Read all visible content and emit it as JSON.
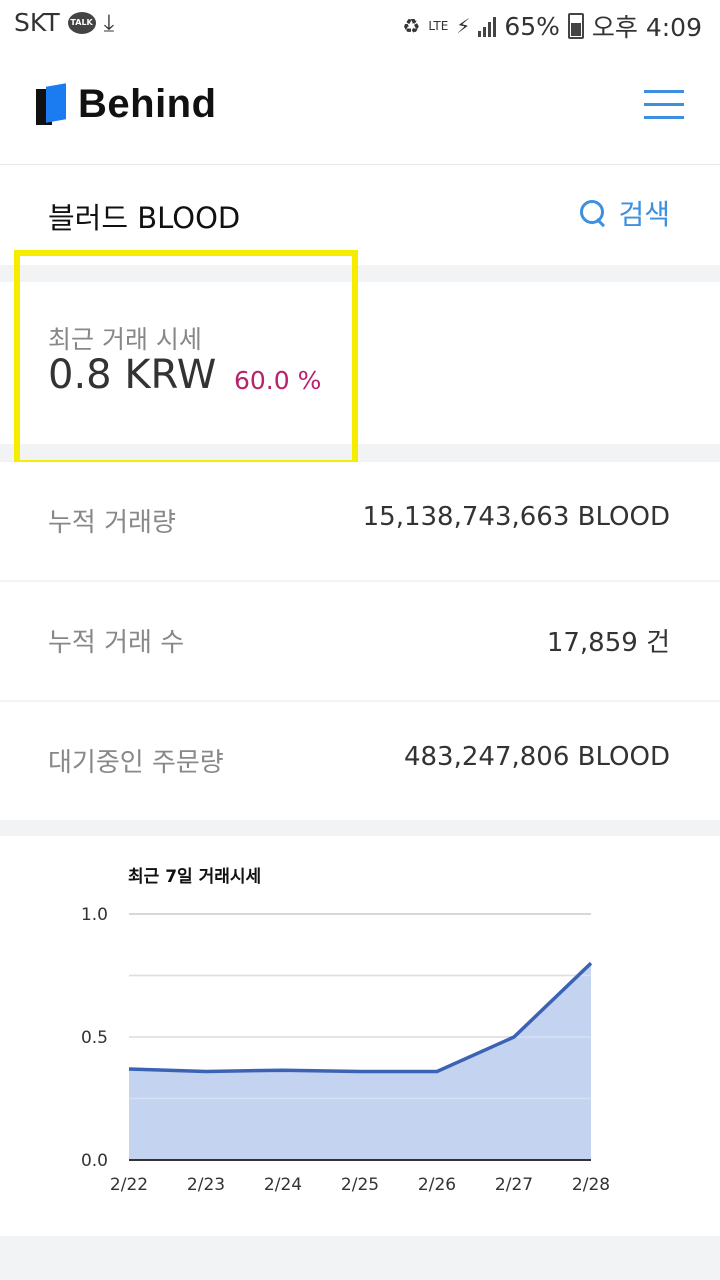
{
  "status_bar": {
    "carrier": "SKT",
    "talk_badge": "TALK",
    "network": "LTE",
    "battery": "65%",
    "time": "오후 4:09"
  },
  "header": {
    "app_name": "Behind"
  },
  "page": {
    "title": "블러드 BLOOD",
    "search_label": "검색"
  },
  "price": {
    "label": "최근 거래 시세",
    "value": "0.8 KRW",
    "change": "60.0 %"
  },
  "stats": [
    {
      "label": "누적 거래량",
      "value": "15,138,743,663 BLOOD"
    },
    {
      "label": "누적 거래 수",
      "value": "17,859 건"
    },
    {
      "label": "대기중인 주문량",
      "value": "483,247,806 BLOOD"
    }
  ],
  "colors": {
    "accent": "#3d8fe0",
    "change": "#b8226a",
    "highlight": "#f5ec00",
    "line": "#3b63b5",
    "area": "#c0d1ef"
  },
  "chart_data": {
    "type": "area",
    "title": "최근 7일 거래시세",
    "categories": [
      "2/22",
      "2/23",
      "2/24",
      "2/25",
      "2/26",
      "2/27",
      "2/28"
    ],
    "values": [
      0.37,
      0.36,
      0.365,
      0.36,
      0.36,
      0.5,
      0.8
    ],
    "ylim": [
      0,
      1
    ],
    "yticks": [
      "1.0",
      "0.5",
      "0.0"
    ],
    "xlabel": "",
    "ylabel": "",
    "grid": true
  }
}
